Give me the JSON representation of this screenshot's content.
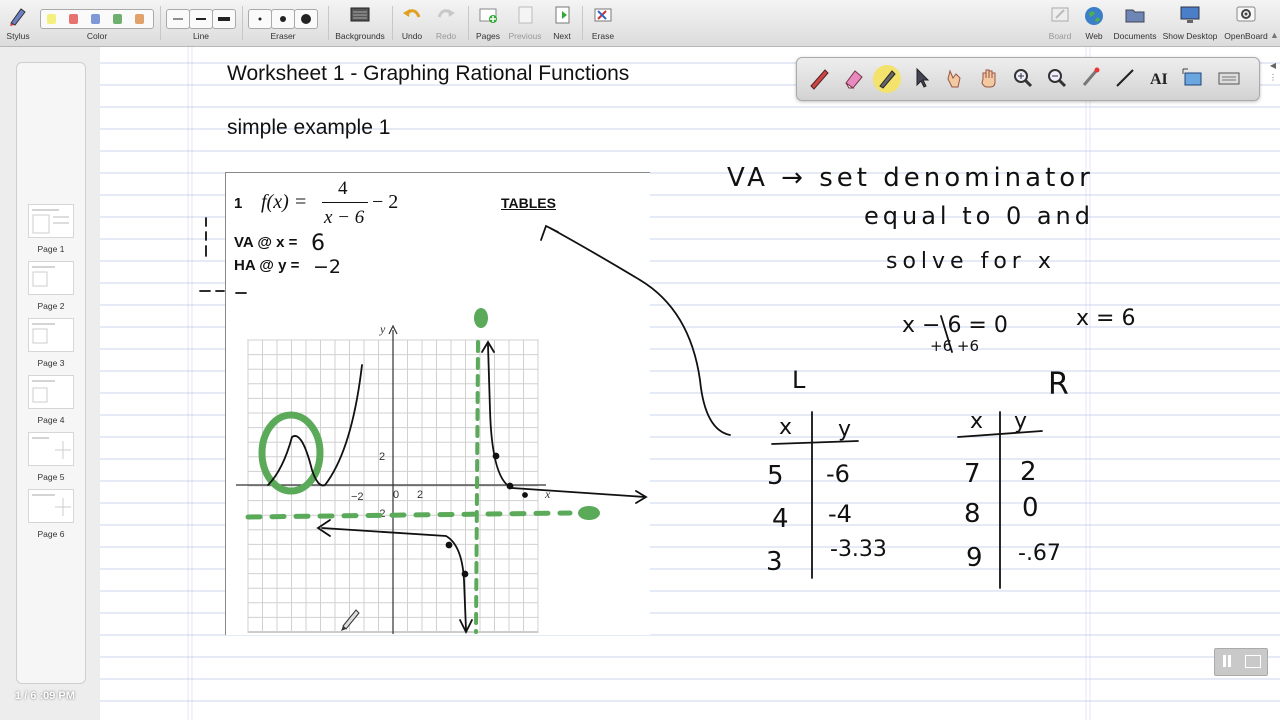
{
  "toolbar": {
    "stylus_label": "Stylus",
    "color_label": "Color",
    "line_label": "Line",
    "eraser_label": "Eraser",
    "backgrounds_label": "Backgrounds",
    "undo_label": "Undo",
    "redo_label": "Redo",
    "pages_label": "Pages",
    "previous_label": "Previous",
    "next_label": "Next",
    "erase_label": "Erase",
    "board_label": "Board",
    "web_label": "Web",
    "documents_label": "Documents",
    "show_desktop_label": "Show Desktop",
    "openboard_label": "OpenBoard",
    "colors": [
      "#f3f080",
      "#e8726f",
      "#7f99d6",
      "#6fb06f",
      "#e0a26a"
    ]
  },
  "sidebar": {
    "pages": [
      {
        "label": "Page 1"
      },
      {
        "label": "Page 2"
      },
      {
        "label": "Page 3"
      },
      {
        "label": "Page 4"
      },
      {
        "label": "Page 5"
      },
      {
        "label": "Page 6"
      }
    ],
    "page_counter": "1 / 6 :09 PM"
  },
  "board": {
    "title": "Worksheet 1 - Graphing Rational Functions",
    "subtitle": "simple example 1",
    "worksheet": {
      "problem_number": "1",
      "function_lhs": "f(x) =",
      "function_numerator": "4",
      "function_denominator": "x − 6",
      "function_constant": "− 2",
      "va_label": "VA @ x =",
      "ha_label": "HA @ y =",
      "tables_label": "TABLES",
      "axis_x": "x",
      "axis_y": "y",
      "tick_labels": [
        "−2",
        "0",
        "2",
        "2",
        "−2"
      ]
    },
    "handwriting": {
      "va_value": "6",
      "ha_value": "−2",
      "vertical_asymptote_marker": "6",
      "note_line1": "VA → set denominator",
      "note_line2": "equal to 0 and",
      "note_line3": "solve for x",
      "equation": "x − 6 = 0",
      "equation_step": "+6  +6",
      "solution": "x = 6",
      "left_label": "L",
      "right_label": "R",
      "left_table": {
        "headers": [
          "x",
          "y"
        ],
        "rows": [
          [
            "5",
            "-6"
          ],
          [
            "4",
            "-4"
          ],
          [
            "3",
            "-3.33"
          ]
        ]
      },
      "right_table": {
        "headers": [
          "x",
          "y"
        ],
        "rows": [
          [
            "7",
            "2"
          ],
          [
            "8",
            "0"
          ],
          [
            "9",
            "-.67"
          ]
        ]
      }
    },
    "ink_colors": {
      "pen": "#111111",
      "green": "#5aaa5a"
    }
  }
}
